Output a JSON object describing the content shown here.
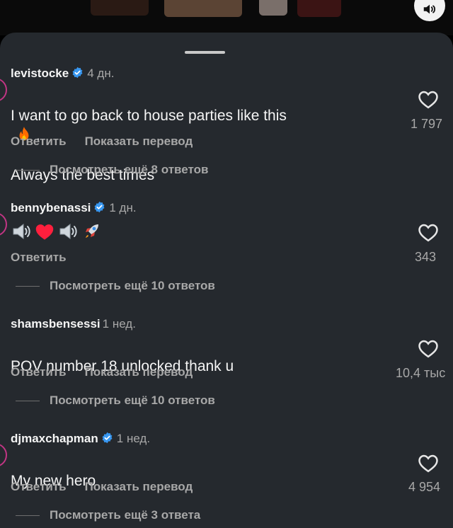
{
  "comments": [
    {
      "username": "levistocke",
      "verified": true,
      "time": "4 дн.",
      "text": "I want to go back to house parties like this",
      "text_tail": ".",
      "text_line2": "Always the best times",
      "reply_label": "Ответить",
      "translate_label": "Показать перевод",
      "likes": "1 797",
      "more_replies": "Посмотреть ещё 8 ответов"
    },
    {
      "username": "bennybenassi",
      "verified": true,
      "time": "1 дн.",
      "emojis": [
        "speaker-icon",
        "heart-icon",
        "speaker-icon",
        "rocket-icon"
      ],
      "reply_label": "Ответить",
      "likes": "343",
      "more_replies": "Посмотреть ещё 10 ответов"
    },
    {
      "username": "shamsbensessi",
      "verified": false,
      "time": "1 нед.",
      "text": "POV number 18 unlocked thank u",
      "reply_label": "Ответить",
      "translate_label": "Показать перевод",
      "likes": "10,4 тыс",
      "more_replies": "Посмотреть ещё 10 ответов"
    },
    {
      "username": "djmaxchapman",
      "verified": true,
      "time": "1 нед.",
      "text": "My new hero",
      "reply_label": "Ответить",
      "translate_label": "Показать перевод",
      "likes": "4 954",
      "more_replies": "Посмотреть ещё 3 ответа"
    }
  ],
  "colors": {
    "sheet": "#25292e",
    "muted": "#a8a8a8",
    "verified": "#3897f0",
    "avatar_ring": "#c13584"
  }
}
